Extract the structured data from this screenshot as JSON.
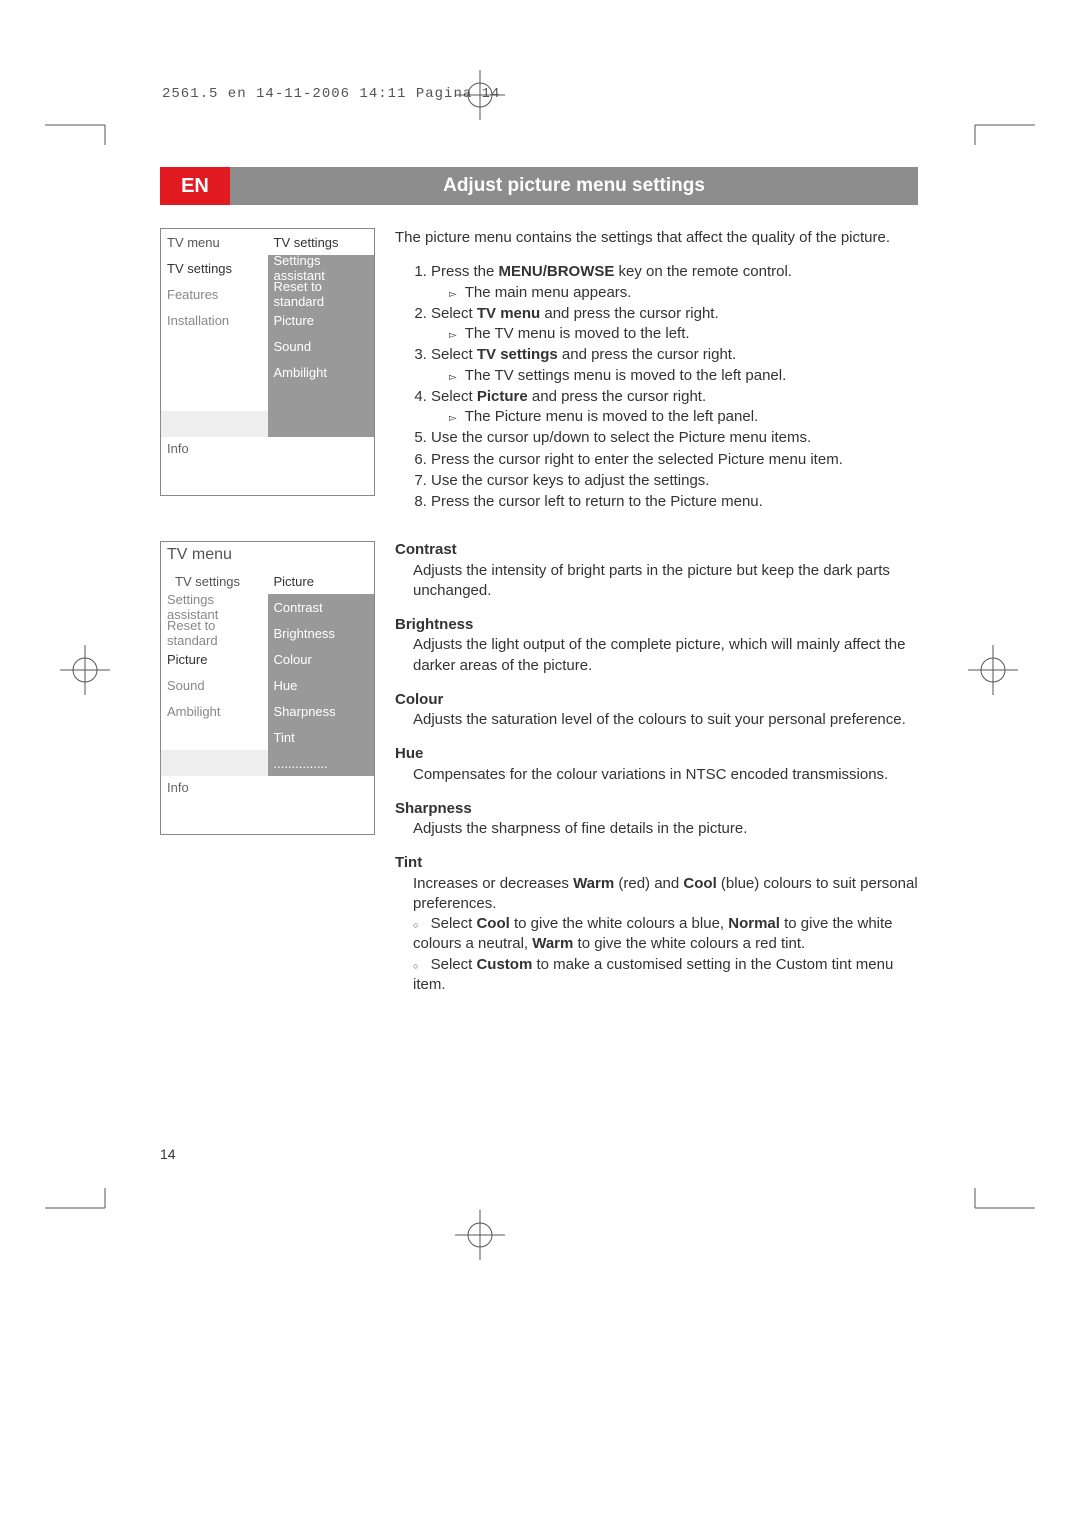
{
  "print_header": "2561.5 en  14-11-2006  14:11  Pagina 14",
  "header": {
    "lang": "EN",
    "title": "Adjust picture menu settings"
  },
  "menu1": {
    "left_title": "TV menu",
    "right_title": "TV settings",
    "left_items": [
      "TV settings",
      "Features",
      "Installation"
    ],
    "right_items": [
      "Settings assistant",
      "Reset to standard",
      "Picture",
      "Sound",
      "Ambilight"
    ],
    "info": "Info"
  },
  "menu2": {
    "title": "TV menu",
    "left_sub": "TV settings",
    "right_sub": "Picture",
    "left_items": [
      "Settings assistant",
      "Reset to standard",
      "Picture",
      "Sound",
      "Ambilight"
    ],
    "right_items": [
      "Contrast",
      "Brightness",
      "Colour",
      "Hue",
      "Sharpness",
      "Tint",
      "..............."
    ],
    "info": "Info"
  },
  "intro": "The picture menu contains the settings that affect the quality of the picture.",
  "steps": [
    {
      "t": "Press the ",
      "b": "MENU/BROWSE",
      "t2": " key on the remote control.",
      "sub": "The main menu appears."
    },
    {
      "t": "Select ",
      "b": "TV menu",
      "t2": " and press the cursor right.",
      "sub": "The TV menu is moved to the left."
    },
    {
      "t": "Select ",
      "b": "TV settings",
      "t2": " and press the cursor right.",
      "sub": "The TV settings menu is moved to the left panel."
    },
    {
      "t": "Select ",
      "b": "Picture",
      "t2": " and press the cursor right.",
      "sub": "The Picture menu is moved to the left panel."
    },
    {
      "t": "Use the cursor up/down to select the Picture menu items."
    },
    {
      "t": "Press the cursor right to enter the selected Picture menu item."
    },
    {
      "t": "Use the cursor keys to adjust the settings."
    },
    {
      "t": "Press the cursor left to return to the Picture menu."
    }
  ],
  "defs": {
    "contrast": {
      "title": "Contrast",
      "body": "Adjusts the intensity of bright parts in the picture but keep the dark parts unchanged."
    },
    "brightness": {
      "title": "Brightness",
      "body": "Adjusts the light output of the complete picture, which will mainly affect the darker areas of the picture."
    },
    "colour": {
      "title": "Colour",
      "body": "Adjusts the saturation level of the colours to suit your personal preference."
    },
    "hue": {
      "title": "Hue",
      "body": "Compensates for the colour variations in NTSC encoded transmissions."
    },
    "sharpness": {
      "title": "Sharpness",
      "body": "Adjusts the sharpness of fine details in the picture."
    },
    "tint": {
      "title": "Tint",
      "intro_a": "Increases or decreases ",
      "warm": "Warm",
      "intro_b": " (red) and ",
      "cool": "Cool",
      "intro_c": " (blue) colours to suit personal preferences.",
      "line2_a": "Select ",
      "line2_b": "Cool",
      "line2_c": " to give the white colours a blue, ",
      "line2_d": "Normal",
      "line2_e": " to give the white colours a neutral, ",
      "line2_f": "Warm",
      "line2_g": " to give the white colours a red tint.",
      "line3_a": "Select ",
      "line3_b": "Custom",
      "line3_c": " to make a customised setting in the Custom tint menu item."
    }
  },
  "page_number": "14"
}
